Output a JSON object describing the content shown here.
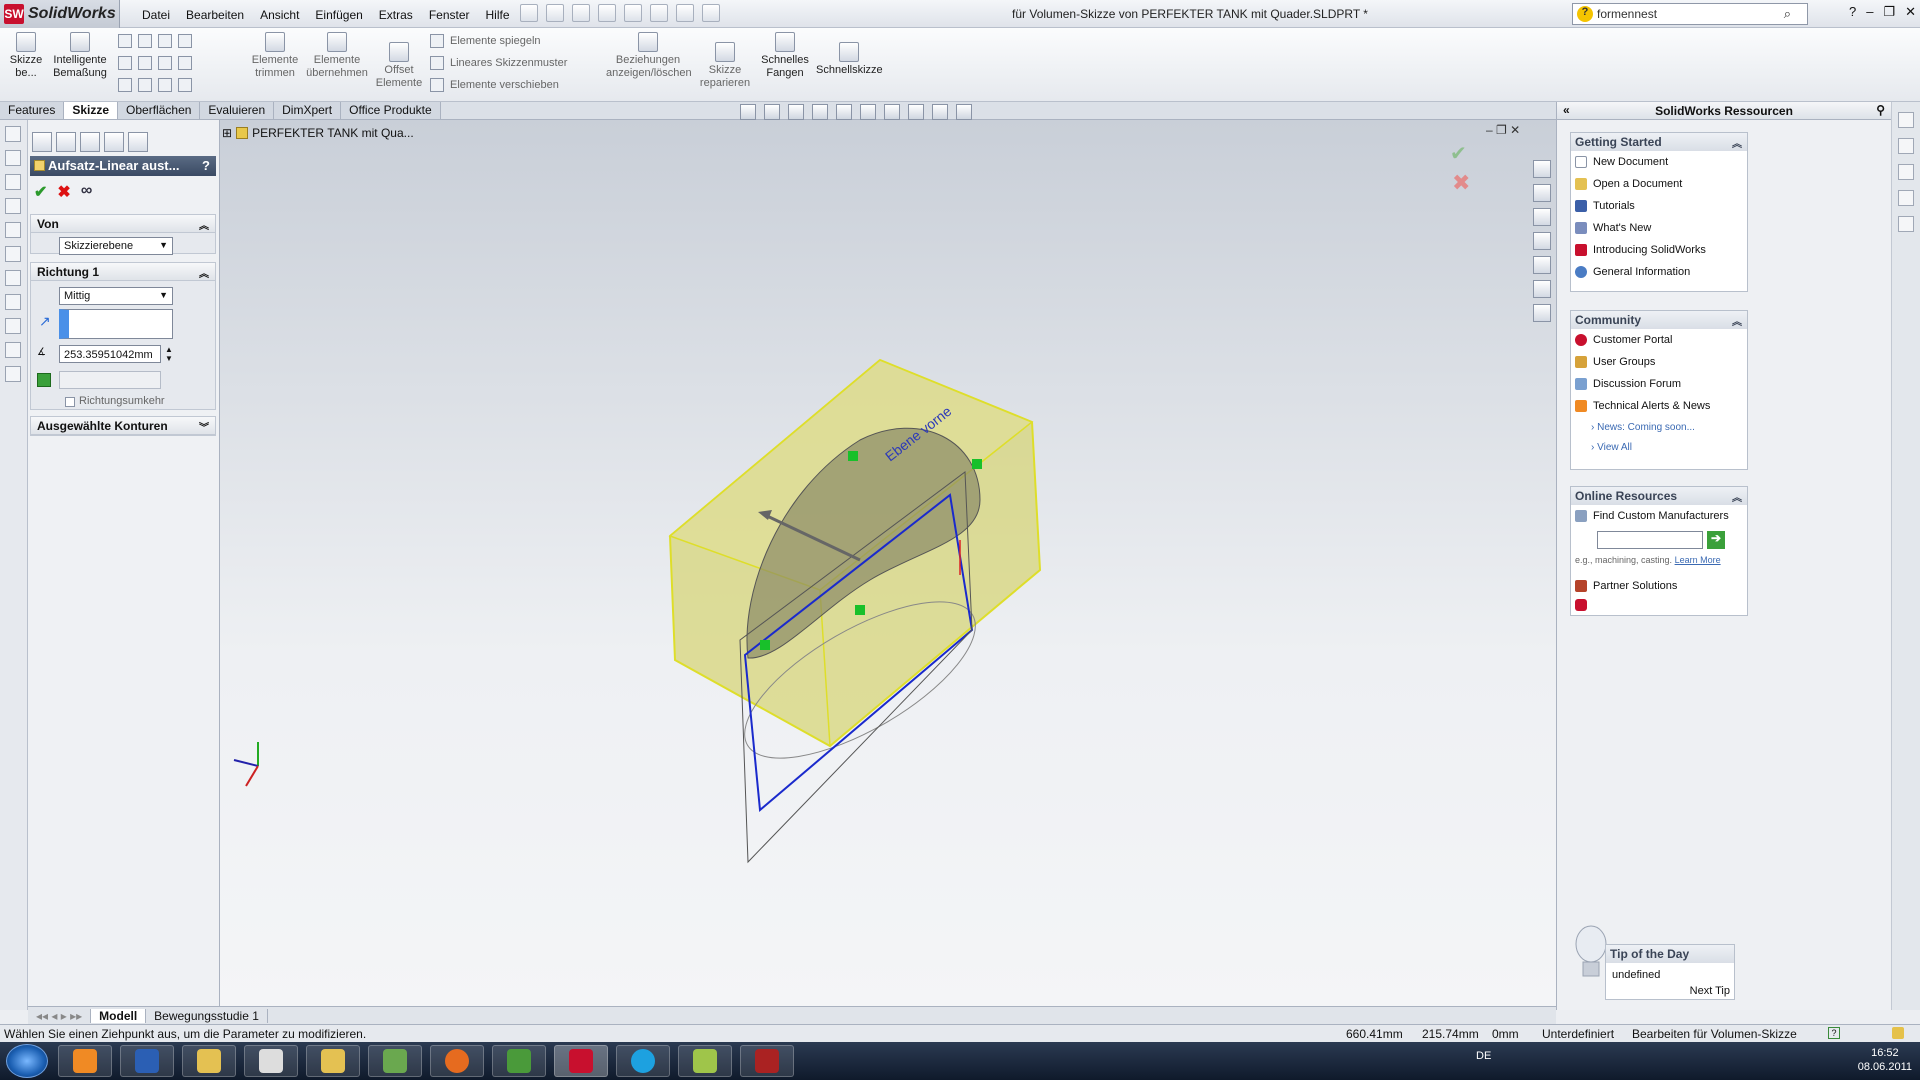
{
  "app": {
    "name": "SolidWorks",
    "document_title": "für Volumen-Skizze von PERFEKTER TANK mit Quader.SLDPRT *",
    "search_text": "formennest"
  },
  "menu": [
    "Datei",
    "Bearbeiten",
    "Ansicht",
    "Einfügen",
    "Extras",
    "Fenster",
    "Hilfe"
  ],
  "ribbon": {
    "skizze": "Skizze\nbe...",
    "bemassung": "Intelligente\nBemaßung",
    "trimmen": "Elemente\ntrimmen",
    "uebernehmen": "Elemente\nübernehmen",
    "offset": "Offset\nElemente",
    "spiegeln": "Elemente spiegeln",
    "muster": "Lineares Skizzenmuster",
    "verschieben": "Elemente verschieben",
    "beziehungen": "Beziehungen\nanzeigen/löschen",
    "reparieren": "Skizze\nreparieren",
    "fangen": "Schnelles\nFangen",
    "schnellskizze": "Schnellskizze"
  },
  "tabs": [
    "Features",
    "Skizze",
    "Oberflächen",
    "Evaluieren",
    "DimXpert",
    "Office Produkte"
  ],
  "tree": {
    "root": "PERFEKTER TANK mit Qua..."
  },
  "property_manager": {
    "title": "Aufsatz-Linear aust...",
    "help": "?",
    "von_label": "Von",
    "von_value": "Skizzierebene",
    "richtung_label": "Richtung 1",
    "richtung_value": "Mittig",
    "distance": "253.35951042mm",
    "reverse_label": "Richtungsumkehr",
    "konturen_label": "Ausgewählte Konturen"
  },
  "viewport": {
    "plane_label": "Ebene vorne"
  },
  "task_pane": {
    "title": "SolidWorks Ressourcen",
    "getting_started": {
      "title": "Getting Started",
      "items": [
        "New Document",
        "Open a Document",
        "Tutorials",
        "What's New",
        "Introducing SolidWorks",
        "General Information"
      ]
    },
    "community": {
      "title": "Community",
      "items": [
        "Customer Portal",
        "User Groups",
        "Discussion Forum",
        "Technical Alerts & News"
      ],
      "news": "News: Coming soon...",
      "view_all": "View All"
    },
    "online": {
      "title": "Online Resources",
      "find": "Find Custom Manufacturers",
      "hint": "e.g., machining, casting.",
      "learn_more": "Learn More",
      "partner": "Partner Solutions"
    },
    "tip": {
      "title": "Tip of the Day",
      "text": "undefined",
      "next": "Next Tip"
    }
  },
  "bottom_tabs": [
    "Modell",
    "Bewegungsstudie 1"
  ],
  "status": {
    "message": "Wählen Sie einen Ziehpunkt aus, um die Parameter zu modifizieren.",
    "x": "660.41mm",
    "y": "215.74mm",
    "z": "0mm",
    "state": "Unterdefiniert",
    "mode": "Bearbeiten für Volumen-Skizze"
  },
  "taskbar": {
    "lang": "DE",
    "time": "16:52",
    "date": "08.06.2011"
  },
  "colors": {
    "accent": "#c8102e",
    "sketch_blue": "#1a2acc",
    "body_yellow": "#d7d67a"
  }
}
